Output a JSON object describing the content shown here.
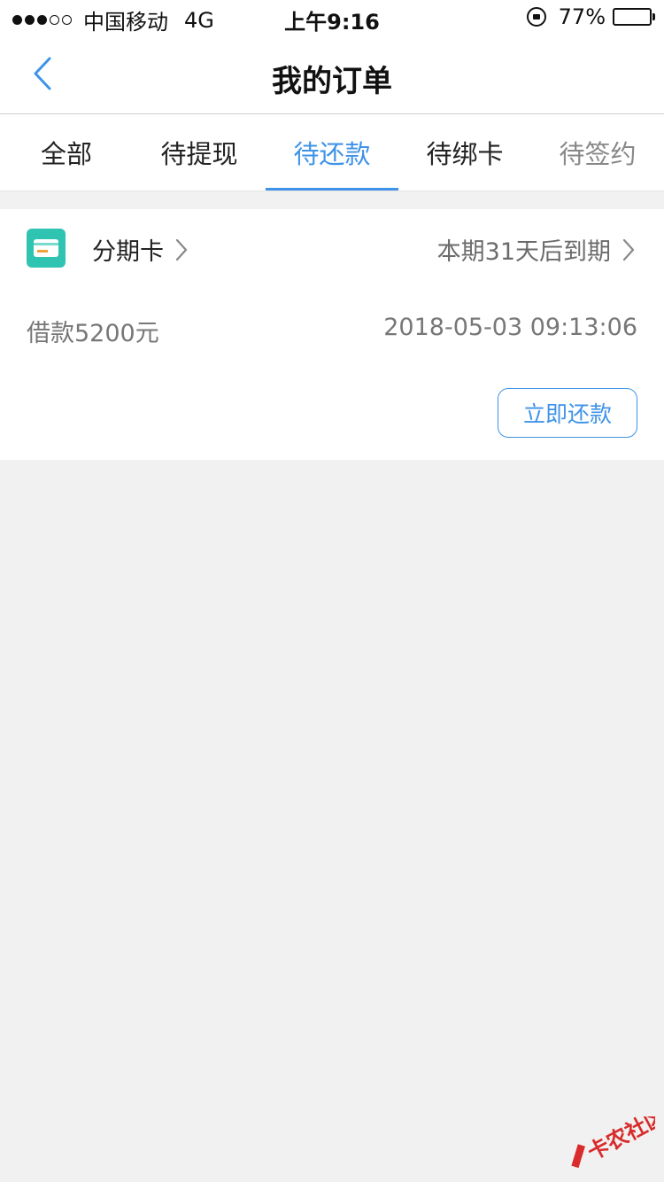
{
  "status_bar": {
    "carrier": "中国移动",
    "network": "4G",
    "time": "上午9:16",
    "battery": "77%",
    "battery_level": 0.77
  },
  "header": {
    "title": "我的订单"
  },
  "tabs": [
    {
      "label": "全部",
      "active": false
    },
    {
      "label": "待提现",
      "active": false
    },
    {
      "label": "待还款",
      "active": true
    },
    {
      "label": "待绑卡",
      "active": false
    },
    {
      "label": "待签约",
      "active": false
    }
  ],
  "order": {
    "product_name": "分期卡",
    "due_text": "本期31天后到期",
    "loan_amount": "借款5200元",
    "datetime": "2018-05-03 09:13:06",
    "repay_label": "立即还款"
  },
  "watermark": {
    "text": "卡农社区"
  },
  "colors": {
    "accent": "#3f93e8",
    "logo": "#2fc4b2",
    "watermark": "#d92b2b"
  },
  "icons": {
    "back": "chevron-left-icon",
    "chevron": "chevron-right-icon",
    "logo": "card-logo-icon"
  }
}
